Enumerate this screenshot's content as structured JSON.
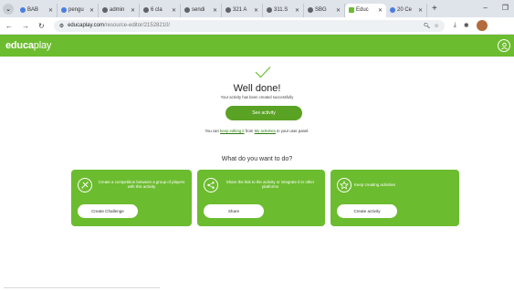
{
  "browser": {
    "tabs": [
      {
        "label": "BAB",
        "icon": "globe-icon"
      },
      {
        "label": "pengu",
        "icon": "globe-icon"
      },
      {
        "label": "admin",
        "icon": "globe-icon"
      },
      {
        "label": "6 cla",
        "icon": "globe-icon"
      },
      {
        "label": "sendi",
        "icon": "globe-icon"
      },
      {
        "label": "321 A",
        "icon": "globe-icon"
      },
      {
        "label": "311.S",
        "icon": "globe-icon"
      },
      {
        "label": "SBG",
        "icon": "globe-icon"
      },
      {
        "label": "Educ",
        "icon": "educaplay-icon",
        "active": true
      },
      {
        "label": "20 Ce",
        "icon": "globe-icon"
      }
    ],
    "url_host": "educaplay.com",
    "url_path": "/resource-editor/21528210/"
  },
  "site": {
    "logo_bold": "educa",
    "logo_light": "play"
  },
  "success": {
    "title": "Well done!",
    "subtitle": "Your activity has been created successfully",
    "see_button": "See activity",
    "edit_prefix": "You can ",
    "edit_link": "keep editing it",
    "edit_middle": " from ",
    "activities_link": "My activities",
    "edit_suffix": " in your user panel."
  },
  "next": {
    "heading": "What do you want to do?",
    "cards": [
      {
        "text": "Create a competition between a group of players with this activity",
        "button": "Create Challenge",
        "icon": "challenge-icon"
      },
      {
        "text": "Share the link to the activity or integrate it in other platforms",
        "button": "Share",
        "icon": "share-icon"
      },
      {
        "text": "Keep creating activities",
        "button": "Create activity",
        "icon": "create-icon"
      }
    ]
  },
  "colors": {
    "brand_green": "#6cbc2f",
    "button_green": "#5aa224"
  }
}
